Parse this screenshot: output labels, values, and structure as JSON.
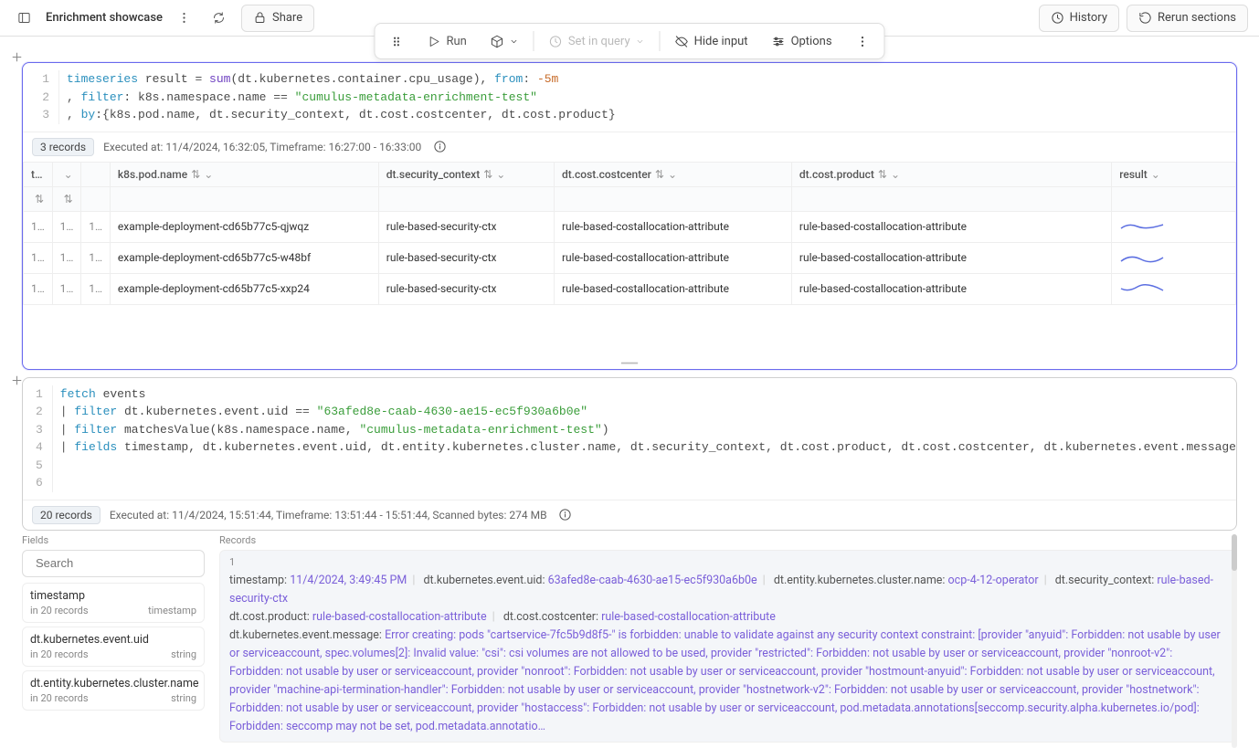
{
  "page": {
    "title": "Enrichment showcase"
  },
  "topbar": {
    "share": "Share",
    "history": "History",
    "rerun": "Rerun sections"
  },
  "toolbar": {
    "run": "Run",
    "set_in_query": "Set in query",
    "hide_input": "Hide input",
    "options": "Options"
  },
  "section1": {
    "code": {
      "l1_a": "timeseries",
      "l1_b": " result ",
      "l1_c": "=",
      "l1_d": " sum",
      "l1_e": "(dt.kubernetes.container.cpu_usage), ",
      "l1_f": "from",
      "l1_g": ": ",
      "l1_h": "-5m",
      "l2_a": ", ",
      "l2_b": "filter",
      "l2_c": ": k8s.namespace.name ",
      "l2_d": "==",
      "l2_e": " ",
      "l2_f": "\"cumulus-metadata-enrichment-test\"",
      "l3_a": ", ",
      "l3_b": "by",
      "l3_c": ":{k8s.pod.name, dt.security_context, dt.cost.costcenter, dt.cost.product}"
    },
    "records_count": "3 records",
    "executed": "Executed at: 11/4/2024, 16:32:05, Timeframe: 16:27:00 - 16:33:00",
    "columns": {
      "c0": "ti…",
      "c1": "k8s.pod.name",
      "c2": "dt.security_context",
      "c3": "dt.cost.costcenter",
      "c4": "dt.cost.product",
      "c5": "result"
    },
    "rows": [
      {
        "a": "1…",
        "b": "1…",
        "c": "1…",
        "pod": "example-deployment-cd65b77c5-qjwqz",
        "sec": "rule-based-security-ctx",
        "cc": "rule-based-costallocation-attribute",
        "prod": "rule-based-costallocation-attribute"
      },
      {
        "a": "1…",
        "b": "1…",
        "c": "1…",
        "pod": "example-deployment-cd65b77c5-w48bf",
        "sec": "rule-based-security-ctx",
        "cc": "rule-based-costallocation-attribute",
        "prod": "rule-based-costallocation-attribute"
      },
      {
        "a": "1…",
        "b": "1…",
        "c": "1…",
        "pod": "example-deployment-cd65b77c5-xxp24",
        "sec": "rule-based-security-ctx",
        "cc": "rule-based-costallocation-attribute",
        "prod": "rule-based-costallocation-attribute"
      }
    ]
  },
  "section2": {
    "code": {
      "l1_a": "fetch",
      "l1_b": " events",
      "l2_a": "| ",
      "l2_b": "filter",
      "l2_c": " dt.kubernetes.event.uid ",
      "l2_d": "==",
      "l2_e": " ",
      "l2_f": "\"63afed8e-caab-4630-ae15-ec5f930a6b0e\"",
      "l3_a": "| ",
      "l3_b": "filter",
      "l3_c": " matchesValue(k8s.namespace.name, ",
      "l3_d": "\"cumulus-metadata-enrichment-test\"",
      "l3_e": ")",
      "l4_a": "| ",
      "l4_b": "fields",
      "l4_c": " timestamp, dt.kubernetes.event.uid, dt.entity.kubernetes.cluster.name, dt.security_context, dt.cost.product, dt.cost.costcenter, dt.kubernetes.event.message",
      "l5": "",
      "l6": ""
    },
    "records_count": "20 records",
    "executed": "Executed at: 11/4/2024, 15:51:44, Timeframe: 13:51:44 - 15:51:44, Scanned bytes: 274 MB",
    "fields_label": "Fields",
    "records_label": "Records",
    "search_placeholder": "Search",
    "fields": [
      {
        "name": "timestamp",
        "count": "in 20 records",
        "type": "timestamp"
      },
      {
        "name": "dt.kubernetes.event.uid",
        "count": "in 20 records",
        "type": "string"
      },
      {
        "name": "dt.entity.kubernetes.cluster.name",
        "count": "in 20 records",
        "type": "string"
      }
    ],
    "record1": {
      "idx": "1",
      "ts_k": "timestamp:",
      "ts_v": "11/4/2024, 3:49:45 PM",
      "uid_k": "dt.kubernetes.event.uid:",
      "uid_v": "63afed8e-caab-4630-ae15-ec5f930a6b0e",
      "cluster_k": "dt.entity.kubernetes.cluster.name:",
      "cluster_v": "ocp-4-12-operator",
      "sec_k": "dt.security_context:",
      "sec_v": "rule-based-security-ctx",
      "prod_k": "dt.cost.product:",
      "prod_v": "rule-based-costallocation-attribute",
      "cc_k": "dt.cost.costcenter:",
      "cc_v": "rule-based-costallocation-attribute",
      "msg_k": "dt.kubernetes.event.message:",
      "msg_v": "Error creating: pods \"cartservice-7fc5b9d8f5-\" is forbidden: unable to validate against any security context constraint: [provider \"anyuid\": Forbidden: not usable by user or serviceaccount, spec.volumes[2]: Invalid value: \"csi\": csi volumes are not allowed to be used, provider \"restricted\": Forbidden: not usable by user or serviceaccount, provider \"nonroot-v2\": Forbidden: not usable by user or serviceaccount, provider \"nonroot\": Forbidden: not usable by user or serviceaccount, provider \"hostmount-anyuid\": Forbidden: not usable by user or serviceaccount, provider \"machine-api-termination-handler\": Forbidden: not usable by user or serviceaccount, provider \"hostnetwork-v2\": Forbidden: not usable by user or serviceaccount, provider \"hostnetwork\": Forbidden: not usable by user or serviceaccount, provider \"hostaccess\": Forbidden: not usable by user or serviceaccount, pod.metadata.annotations[seccomp.security.alpha.kubernetes.io/pod]: Forbidden: seccomp may not be set, pod.metadata.annotatio…"
    }
  }
}
